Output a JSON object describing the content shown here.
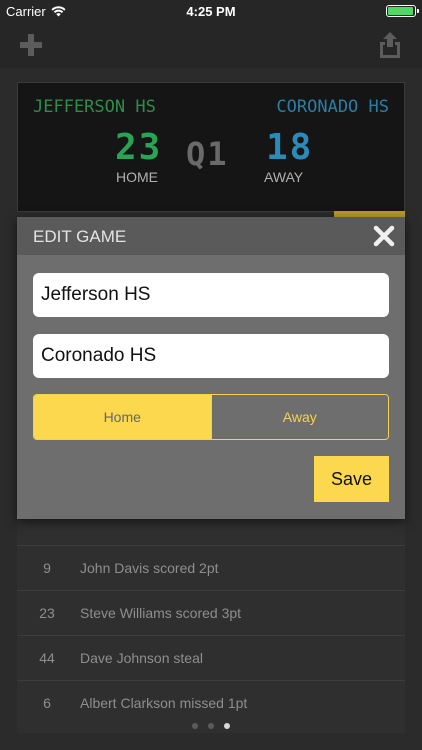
{
  "status_bar": {
    "carrier": "Carrier",
    "time": "4:25 PM"
  },
  "toolbar": {
    "add_icon": "plus-icon",
    "share_icon": "share-icon"
  },
  "scoreboard": {
    "home_team": "JEFFERSON HS",
    "away_team": "CORONADO HS",
    "home_score": "23",
    "away_score": "18",
    "period": "Q1",
    "home_label": "HOME",
    "away_label": "AWAY",
    "home_color": "#29a455",
    "away_color": "#2a8bb9"
  },
  "modal": {
    "title": "EDIT GAME",
    "home_team_value": "Jefferson HS",
    "away_team_value": "Coronado HS",
    "segment": {
      "options": [
        "Home",
        "Away"
      ],
      "selected": "Home"
    },
    "save_label": "Save",
    "accent": "#fbd84e"
  },
  "plays": [
    {
      "number": "9",
      "text": "John Davis scored 2pt"
    },
    {
      "number": "23",
      "text": "Steve Williams scored 3pt"
    },
    {
      "number": "44",
      "text": "Dave Johnson steal"
    },
    {
      "number": "6",
      "text": "Albert Clarkson missed 1pt"
    }
  ],
  "page_indicator": {
    "count": 3,
    "active": 3
  }
}
